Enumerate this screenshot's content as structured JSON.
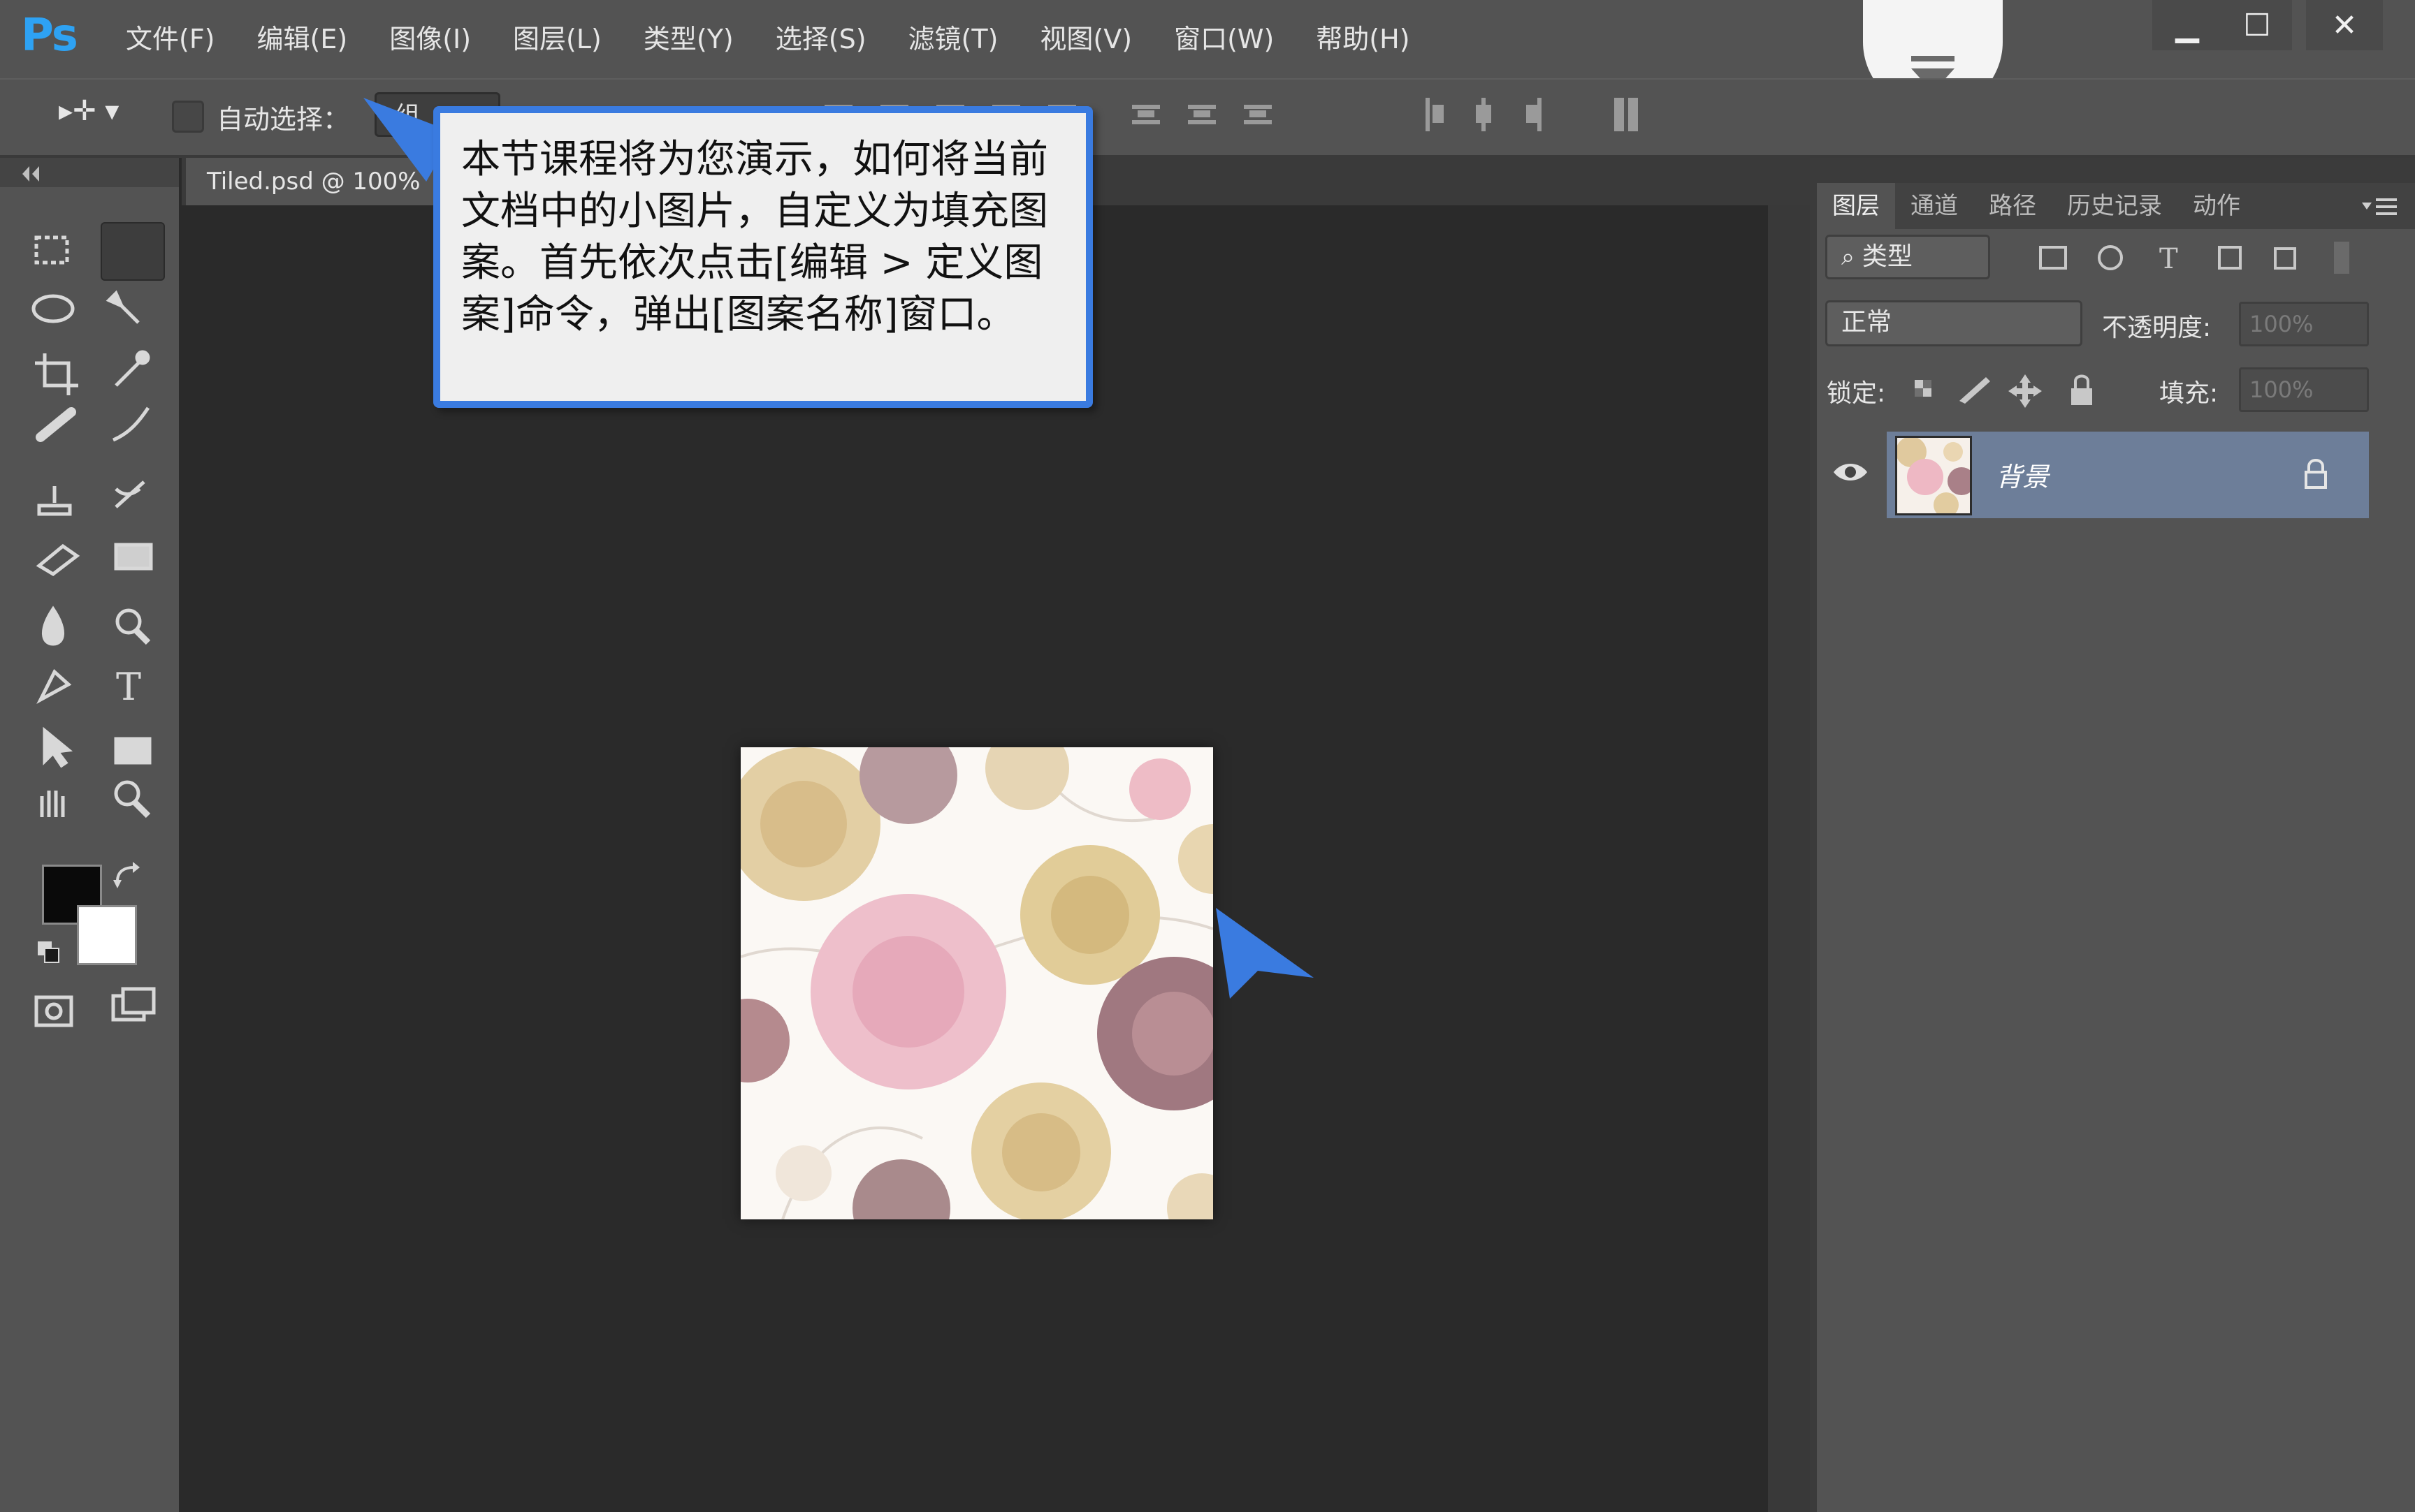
{
  "app": {
    "logo": "Ps"
  },
  "menu": [
    "文件(F)",
    "编辑(E)",
    "图像(I)",
    "图层(L)",
    "类型(Y)",
    "选择(S)",
    "滤镜(T)",
    "视图(V)",
    "窗口(W)",
    "帮助(H)"
  ],
  "window_controls": {
    "minimize": "▁",
    "maximize": "☐",
    "close": "✕"
  },
  "options_bar": {
    "tool_glyph": "▸✛ ▾",
    "auto_select_label": "自动选择：",
    "auto_select_checked": false,
    "target_value": "组"
  },
  "document": {
    "tab_title": "Tiled.psd @ 100%"
  },
  "tooltip": {
    "text": "本节课程将为您演示，如何将当前文档中的小图片，自定义为填充图案。首先依次点击[编辑 > 定义图案]命令，弹出[图案名称]窗口。"
  },
  "layers_panel": {
    "tabs": [
      "图层",
      "通道",
      "路径",
      "历史记录",
      "动作"
    ],
    "active_tab": "图层",
    "filter_label": "类型",
    "blend_mode": "正常",
    "opacity_label": "不透明度:",
    "opacity_value": "100%",
    "lock_label": "锁定:",
    "fill_label": "填充:",
    "fill_value": "100%",
    "layers": [
      {
        "name": "背景",
        "visible": true,
        "locked": true
      }
    ]
  },
  "colors": {
    "accent": "#3a7be0",
    "ps_blue": "#2ea2f3",
    "foreground": "#0a0a0a",
    "background": "#ffffff",
    "layer_selected": "#6d7e99"
  }
}
